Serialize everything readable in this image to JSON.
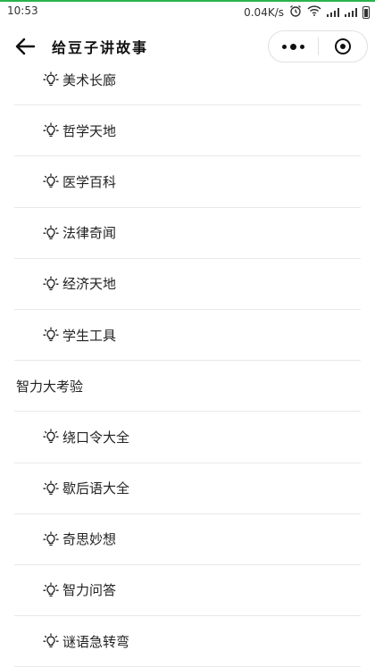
{
  "status_bar": {
    "time": "10:53",
    "network_speed": "0.04K/s"
  },
  "header": {
    "title": "给豆子讲故事"
  },
  "list": [
    {
      "type": "item",
      "label": "美术长廊",
      "icon": "lightbulb-icon"
    },
    {
      "type": "item",
      "label": "哲学天地",
      "icon": "lightbulb-icon"
    },
    {
      "type": "item",
      "label": "医学百科",
      "icon": "lightbulb-icon"
    },
    {
      "type": "item",
      "label": "法律奇闻",
      "icon": "lightbulb-icon"
    },
    {
      "type": "item",
      "label": "经济天地",
      "icon": "lightbulb-icon"
    },
    {
      "type": "item",
      "label": "学生工具",
      "icon": "lightbulb-icon"
    },
    {
      "type": "section",
      "label": "智力大考验"
    },
    {
      "type": "item",
      "label": "绕口令大全",
      "icon": "lightbulb-icon"
    },
    {
      "type": "item",
      "label": "歇后语大全",
      "icon": "lightbulb-icon"
    },
    {
      "type": "item",
      "label": "奇思妙想",
      "icon": "lightbulb-icon"
    },
    {
      "type": "item",
      "label": "智力问答",
      "icon": "lightbulb-icon"
    },
    {
      "type": "item",
      "label": "谜语急转弯",
      "icon": "lightbulb-icon"
    }
  ],
  "colors": {
    "status_accent": "#2bb24c",
    "divider": "#e8e8e8",
    "text": "#222222"
  }
}
